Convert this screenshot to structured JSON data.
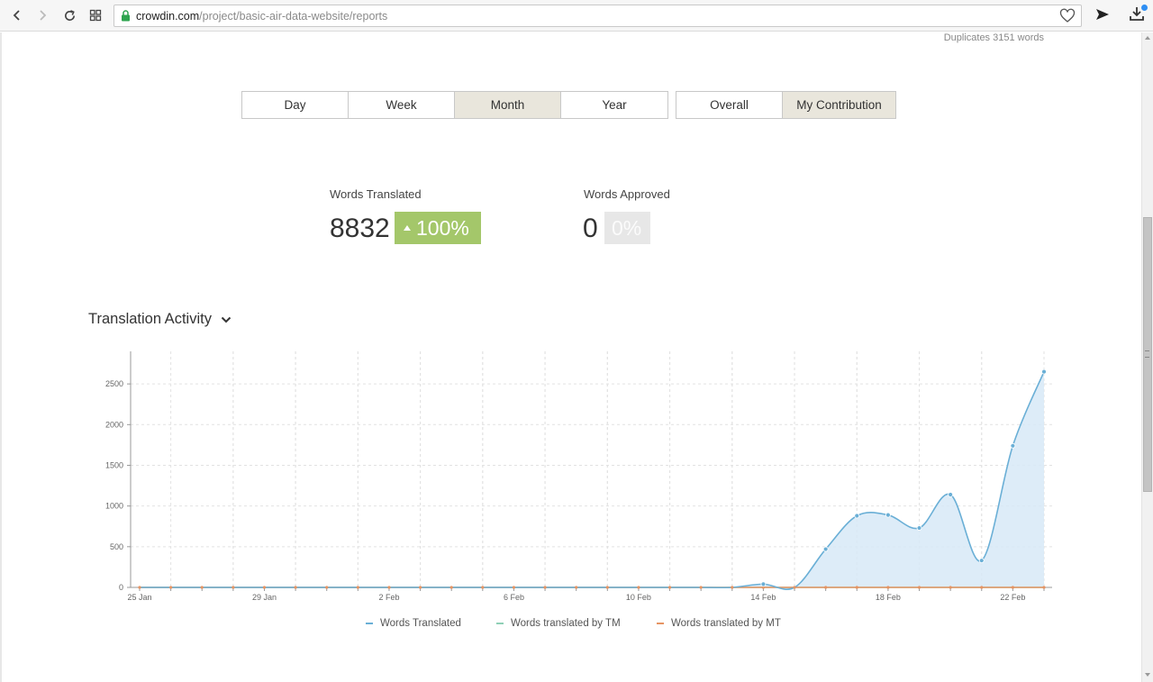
{
  "browser": {
    "url_host": "crowdin.com",
    "url_path": "/project/basic-air-data-website/reports"
  },
  "page": {
    "duplicates": "Duplicates 3151 words",
    "periods": [
      "Day",
      "Week",
      "Month",
      "Year"
    ],
    "active_period": "Month",
    "scopes": [
      "Overall",
      "My Contribution"
    ],
    "active_scope": "My Contribution"
  },
  "stats": {
    "translated": {
      "label": "Words Translated",
      "value": "8832",
      "change": "100%"
    },
    "approved": {
      "label": "Words Approved",
      "value": "0",
      "change": "0%"
    }
  },
  "activity": {
    "title": "Translation Activity"
  },
  "colors": {
    "translated": "#6aafd6",
    "tm": "#8fd0b6",
    "mt": "#e69463",
    "area": "#d7e9f7",
    "badge_green": "#a4c76a"
  },
  "chart_data": {
    "type": "area",
    "x": [
      "25 Jan",
      "26 Jan",
      "27 Jan",
      "28 Jan",
      "29 Jan",
      "30 Jan",
      "31 Jan",
      "1 Feb",
      "2 Feb",
      "3 Feb",
      "4 Feb",
      "5 Feb",
      "6 Feb",
      "7 Feb",
      "8 Feb",
      "9 Feb",
      "10 Feb",
      "11 Feb",
      "12 Feb",
      "13 Feb",
      "14 Feb",
      "15 Feb",
      "16 Feb",
      "17 Feb",
      "18 Feb",
      "19 Feb",
      "20 Feb",
      "21 Feb",
      "22 Feb",
      "23 Feb"
    ],
    "x_tick_labels": [
      "25 Jan",
      "29 Jan",
      "2 Feb",
      "6 Feb",
      "10 Feb",
      "14 Feb",
      "18 Feb",
      "22 Feb"
    ],
    "y_ticks": [
      0,
      500,
      1000,
      1500,
      2000,
      2500
    ],
    "ylim": [
      0,
      2900
    ],
    "grid": true,
    "legend": "bottom",
    "series": [
      {
        "name": "Words Translated",
        "values": [
          0,
          0,
          0,
          0,
          0,
          0,
          0,
          0,
          0,
          0,
          0,
          0,
          0,
          0,
          0,
          0,
          0,
          0,
          0,
          0,
          40,
          0,
          470,
          880,
          890,
          730,
          1140,
          330,
          1740,
          2650
        ]
      },
      {
        "name": "Words translated by TM",
        "values": [
          0,
          0,
          0,
          0,
          0,
          0,
          0,
          0,
          0,
          0,
          0,
          0,
          0,
          0,
          0,
          0,
          0,
          0,
          0,
          0,
          0,
          0,
          0,
          0,
          0,
          0,
          0,
          0,
          0,
          0
        ]
      },
      {
        "name": "Words translated by MT",
        "values": [
          0,
          0,
          0,
          0,
          0,
          0,
          0,
          0,
          0,
          0,
          0,
          0,
          0,
          0,
          0,
          0,
          0,
          0,
          0,
          0,
          0,
          0,
          0,
          0,
          0,
          0,
          0,
          0,
          0,
          0
        ]
      }
    ]
  }
}
